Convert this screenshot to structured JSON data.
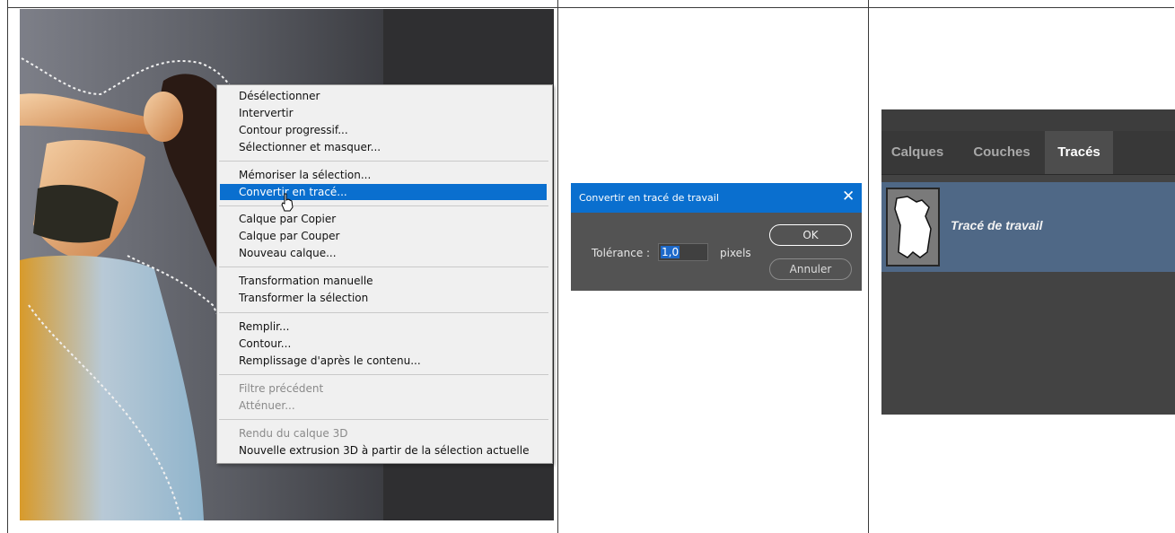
{
  "context_menu": {
    "items": [
      {
        "label": "Désélectionner"
      },
      {
        "label": "Intervertir"
      },
      {
        "label": "Contour progressif..."
      },
      {
        "label": "Sélectionner et masquer..."
      },
      {
        "label": "Mémoriser la sélection..."
      },
      {
        "label": "Convertir en tracé..."
      },
      {
        "label": "Calque par Copier"
      },
      {
        "label": "Calque par Couper"
      },
      {
        "label": "Nouveau calque..."
      },
      {
        "label": "Transformation manuelle"
      },
      {
        "label": "Transformer la sélection"
      },
      {
        "label": "Remplir..."
      },
      {
        "label": "Contour..."
      },
      {
        "label": "Remplissage d'après le contenu..."
      },
      {
        "label": "Filtre précédent"
      },
      {
        "label": "Atténuer..."
      },
      {
        "label": "Rendu du calque 3D"
      },
      {
        "label": "Nouvelle extrusion 3D à partir de la sélection actuelle"
      }
    ],
    "highlighted_item": "Convertir en tracé...",
    "disabled_items": [
      "Filtre précédent",
      "Atténuer...",
      "Rendu du calque 3D"
    ]
  },
  "dialog": {
    "title": "Convertir en tracé de travail",
    "close_glyph": "✕",
    "tolerance_label": "Tolérance :",
    "tolerance_value": "1,0",
    "unit": "pixels",
    "ok_label": "OK",
    "cancel_label": "Annuler"
  },
  "panel": {
    "tabs": [
      {
        "label": "Calques"
      },
      {
        "label": "Couches"
      },
      {
        "label": "Tracés"
      }
    ],
    "active_tab": "Tracés",
    "path_item": {
      "label": "Tracé de travail",
      "icon": "path-thumbnail-icon"
    }
  },
  "colors": {
    "highlight": "#0a6fcf",
    "dialog_title_bar": "#0a6fcf",
    "selected_row": "#4f6886"
  }
}
